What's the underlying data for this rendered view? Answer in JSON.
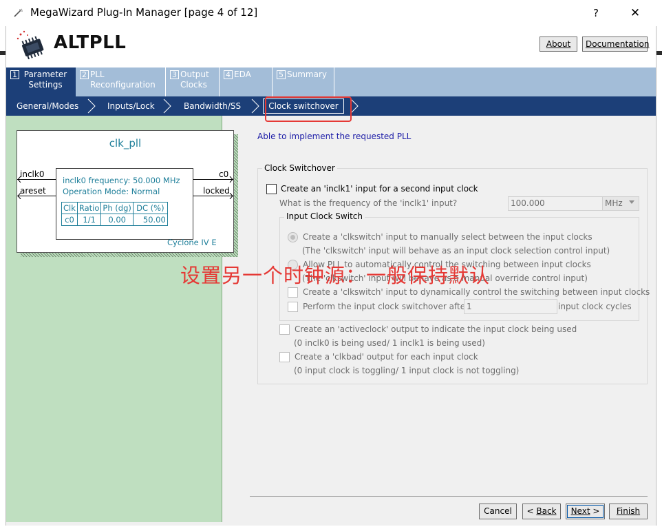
{
  "window": {
    "title": "MegaWizard Plug-In Manager [page 4 of 12]",
    "help": "?",
    "close": "✕"
  },
  "header": {
    "brand": "ALTPLL",
    "about_label": "About",
    "documentation_label": "Documentation"
  },
  "page_tabs": [
    {
      "num": "1",
      "label": "Parameter Settings",
      "active": true
    },
    {
      "num": "2",
      "label": "PLL Reconfiguration",
      "active": false
    },
    {
      "num": "3",
      "label": "Output Clocks",
      "active": false
    },
    {
      "num": "4",
      "label": "EDA",
      "active": false
    },
    {
      "num": "5",
      "label": "Summary",
      "active": false
    }
  ],
  "sub_tabs": [
    {
      "label": "General/Modes"
    },
    {
      "label": "Inputs/Lock"
    },
    {
      "label": "Bandwidth/SS"
    },
    {
      "label": "Clock switchover",
      "active": true
    }
  ],
  "symbol": {
    "name": "clk_pll",
    "inputs": [
      "inclk0",
      "areset"
    ],
    "outputs": [
      "c0",
      "locked"
    ],
    "info_line1": "inclk0 frequency: 50.000 MHz",
    "info_line2": "Operation Mode: Normal",
    "table_headers": [
      "Clk",
      "Ratio",
      "Ph (dg)",
      "DC (%)"
    ],
    "table_row": [
      "c0",
      "1/1",
      "0.00",
      "50.00"
    ],
    "device": "Cyclone IV E"
  },
  "status": "Able to implement the requested PLL",
  "clock_switchover": {
    "legend": "Clock Switchover",
    "create_inclk1_label": "Create an 'inclk1' input for a second input clock",
    "create_inclk1_checked": false,
    "freq_question": "What is the frequency of the 'inclk1' input?",
    "freq_value": "100.000",
    "freq_unit": "MHz",
    "input_clock_switch": {
      "legend": "Input Clock Switch",
      "option_manual": "Create a 'clkswitch' input to manually select between the input clocks",
      "option_manual_note": "(The 'clkswitch' input will behave as an input clock selection control input)",
      "option_auto": "Allow PLL to automatically control the switching between input clocks",
      "option_auto_note": "(The 'clkswitch' input will behave as a manual override control input)",
      "dynamic_label": "Create a 'clkswitch' input to dynamically control the switching between input clocks",
      "switchover_after_label": "Perform the input clock switchover after",
      "switchover_cycles": "1",
      "cycles_suffix": "input clock cycles"
    },
    "activeclock_label": "Create an 'activeclock' output to indicate the input clock being used",
    "activeclock_note": "(0 inclk0 is being used/ 1 inclk1 is being used)",
    "clkbad_label": "Create a 'clkbad' output for each input clock",
    "clkbad_note": "(0 input clock is toggling/ 1 input clock is not toggling)"
  },
  "annotation": "设置另一个时钟源：一般保持默认",
  "footer": {
    "cancel": "Cancel",
    "back_prefix": "< ",
    "back": "Back",
    "next": "Next",
    "next_suffix": " >",
    "finish": "Finish"
  },
  "colors": {
    "tab_bar": "#a3bdd8",
    "nav_bar": "#1c3f78",
    "schematic_bg": "#bfdfc0",
    "annotation_red": "#e53935",
    "status_blue": "#1a1aa6"
  }
}
